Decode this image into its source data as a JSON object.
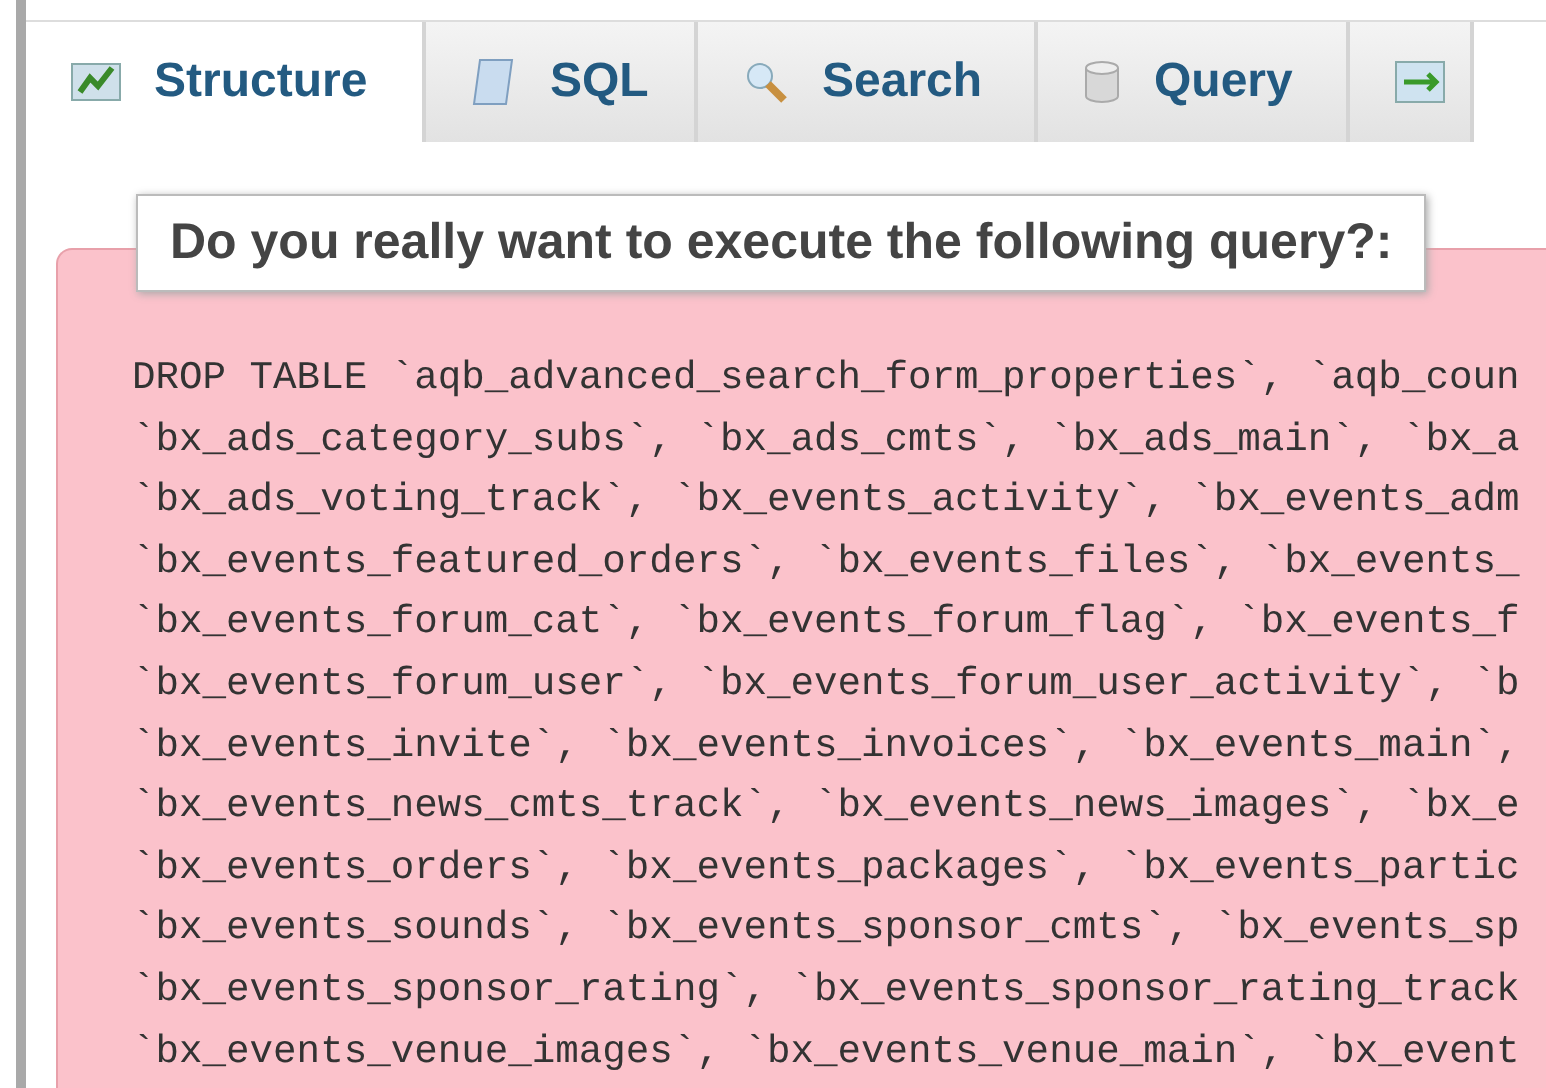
{
  "tabs": [
    {
      "label": "Structure",
      "kind": "structure",
      "selected": true
    },
    {
      "label": "SQL",
      "kind": "sql",
      "selected": false
    },
    {
      "label": "Search",
      "kind": "search",
      "selected": false
    },
    {
      "label": "Query",
      "kind": "query",
      "selected": false
    },
    {
      "kind": "export",
      "selected": false
    }
  ],
  "dialog": {
    "title": "Do you really want to execute the following query?:",
    "query_lines": [
      "DROP TABLE `aqb_advanced_search_form_properties`, `aqb_coun",
      "`bx_ads_category_subs`, `bx_ads_cmts`, `bx_ads_main`, `bx_a",
      "`bx_ads_voting_track`, `bx_events_activity`, `bx_events_adm",
      "`bx_events_featured_orders`, `bx_events_files`, `bx_events_",
      "`bx_events_forum_cat`, `bx_events_forum_flag`, `bx_events_f",
      "`bx_events_forum_user`, `bx_events_forum_user_activity`, `b",
      "`bx_events_invite`, `bx_events_invoices`, `bx_events_main`,",
      "`bx_events_news_cmts_track`, `bx_events_news_images`, `bx_e",
      "`bx_events_orders`, `bx_events_packages`, `bx_events_partic",
      "`bx_events_sounds`, `bx_events_sponsor_cmts`, `bx_events_sp",
      "`bx_events_sponsor_rating`, `bx_events_sponsor_rating_track",
      "`bx_events_venue_images`, `bx_events_venue_main`, `bx_event"
    ]
  }
}
